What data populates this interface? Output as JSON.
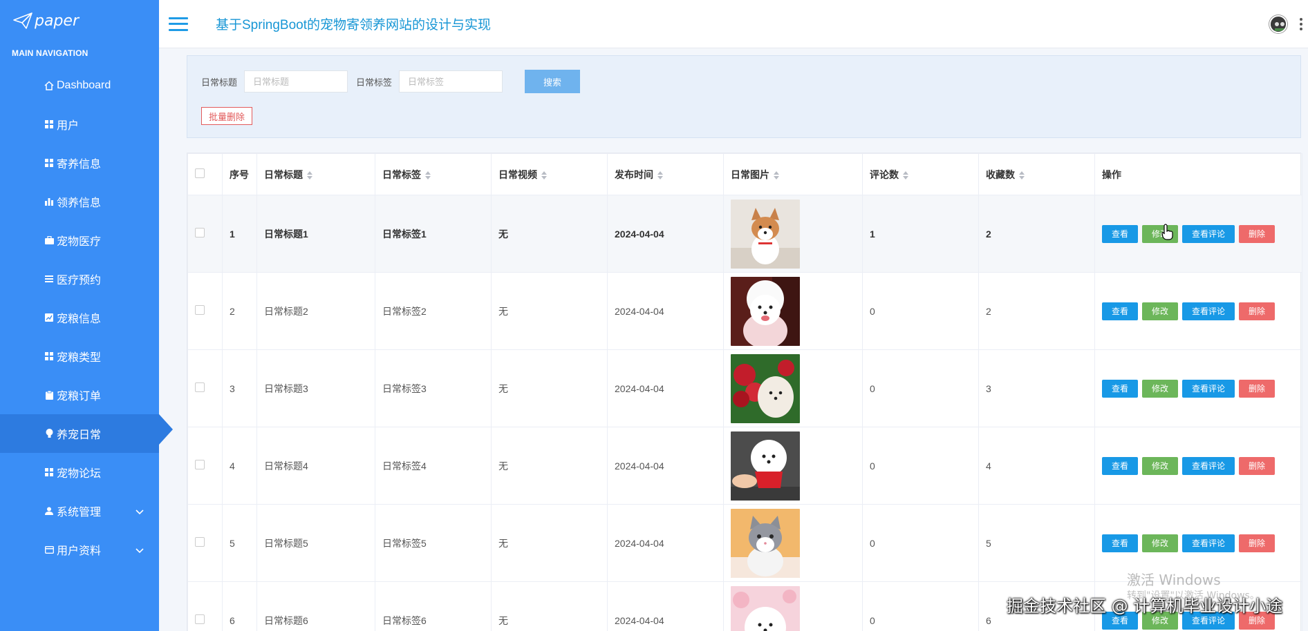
{
  "app": {
    "logo_text": "paper",
    "title": "基于SpringBoot的宠物寄领养网站的设计与实现"
  },
  "sidebar": {
    "heading": "MAIN NAVIGATION",
    "items": [
      {
        "label": "Dashboard",
        "icon": "home-icon"
      },
      {
        "label": "用户",
        "icon": "grid-icon"
      },
      {
        "label": "寄养信息",
        "icon": "grid-icon"
      },
      {
        "label": "领养信息",
        "icon": "bar-chart-icon"
      },
      {
        "label": "宠物医疗",
        "icon": "briefcase-icon"
      },
      {
        "label": "医疗预约",
        "icon": "list-icon"
      },
      {
        "label": "宠粮信息",
        "icon": "chart-icon"
      },
      {
        "label": "宠粮类型",
        "icon": "grid-icon"
      },
      {
        "label": "宠粮订单",
        "icon": "clipboard-icon"
      },
      {
        "label": "养宠日常",
        "icon": "bulb-icon",
        "active": true
      },
      {
        "label": "宠物论坛",
        "icon": "grid-icon"
      },
      {
        "label": "系统管理",
        "icon": "user-icon",
        "expandable": true
      },
      {
        "label": "用户资料",
        "icon": "card-icon",
        "expandable": true
      }
    ]
  },
  "search": {
    "title_label": "日常标题",
    "title_placeholder": "日常标题",
    "tag_label": "日常标签",
    "tag_placeholder": "日常标签",
    "search_button": "搜索",
    "bulk_delete": "批量删除"
  },
  "table": {
    "columns": [
      "序号",
      "日常标题",
      "日常标签",
      "日常视频",
      "发布时间",
      "日常图片",
      "评论数",
      "收藏数",
      "操作"
    ],
    "rows": [
      {
        "no": "1",
        "title": "日常标题1",
        "tag": "日常标签1",
        "video": "无",
        "date": "2024-04-04",
        "comments": "1",
        "favorites": "2"
      },
      {
        "no": "2",
        "title": "日常标题2",
        "tag": "日常标签2",
        "video": "无",
        "date": "2024-04-04",
        "comments": "0",
        "favorites": "2"
      },
      {
        "no": "3",
        "title": "日常标题3",
        "tag": "日常标签3",
        "video": "无",
        "date": "2024-04-04",
        "comments": "0",
        "favorites": "3"
      },
      {
        "no": "4",
        "title": "日常标题4",
        "tag": "日常标签4",
        "video": "无",
        "date": "2024-04-04",
        "comments": "0",
        "favorites": "4"
      },
      {
        "no": "5",
        "title": "日常标题5",
        "tag": "日常标签5",
        "video": "无",
        "date": "2024-04-04",
        "comments": "0",
        "favorites": "5"
      },
      {
        "no": "6",
        "title": "日常标题6",
        "tag": "日常标签6",
        "video": "无",
        "date": "2024-04-04",
        "comments": "0",
        "favorites": "6"
      }
    ],
    "actions": {
      "view": "查看",
      "edit": "修改",
      "comments": "查看评论",
      "delete": "删除"
    }
  },
  "watermarks": {
    "activate_title": "激活 Windows",
    "activate_sub": "转到\"设置\"以激活 Windows。",
    "community": "掘金技术社区 @ 计算机毕业设计小途"
  },
  "colors": {
    "sidebar": "#3a8ef6",
    "sidebar_active": "#2d7be0",
    "title": "#1796d5",
    "view": "#1899e6",
    "edit": "#6cb65a",
    "delete": "#ee6a6a"
  }
}
